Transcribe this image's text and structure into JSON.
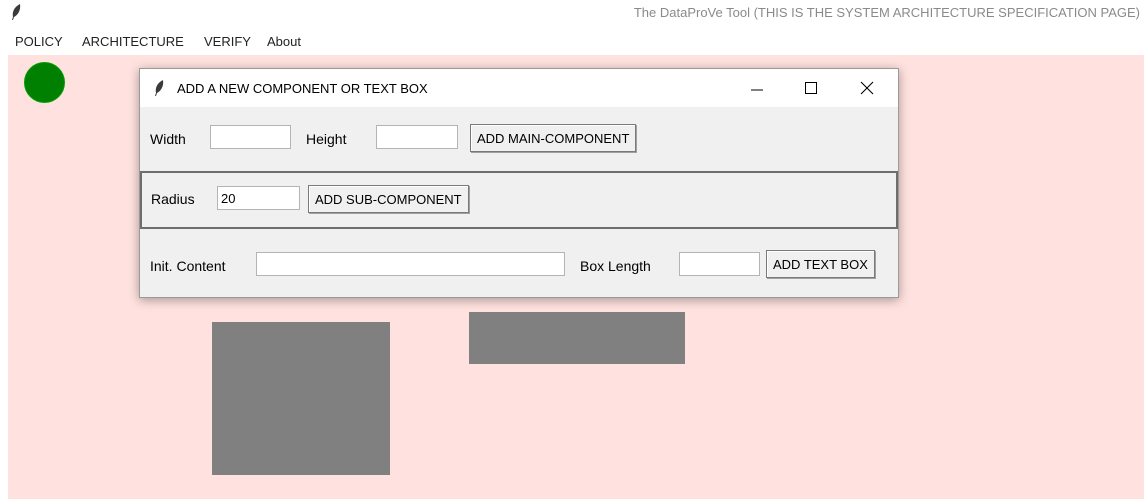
{
  "app": {
    "title": "The DataProVe Tool (THIS IS THE SYSTEM ARCHITECTURE SPECIFICATION PAGE)"
  },
  "menu": [
    "POLICY",
    "ARCHITECTURE",
    "VERIFY",
    "About"
  ],
  "canvas": {
    "background": "#ffe2df",
    "circle_color": "#008000",
    "shape_color": "#808080"
  },
  "dialog": {
    "title": "ADD A NEW COMPONENT OR TEXT BOX",
    "main_component": {
      "width_label": "Width",
      "width_value": "",
      "height_label": "Height",
      "height_value": "",
      "button": "ADD MAIN-COMPONENT"
    },
    "sub_component": {
      "radius_label": "Radius",
      "radius_value": "20",
      "button": "ADD SUB-COMPONENT"
    },
    "text_box": {
      "content_label": "Init. Content",
      "content_value": "",
      "length_label": "Box Length",
      "length_value": "",
      "button": "ADD TEXT BOX"
    }
  }
}
